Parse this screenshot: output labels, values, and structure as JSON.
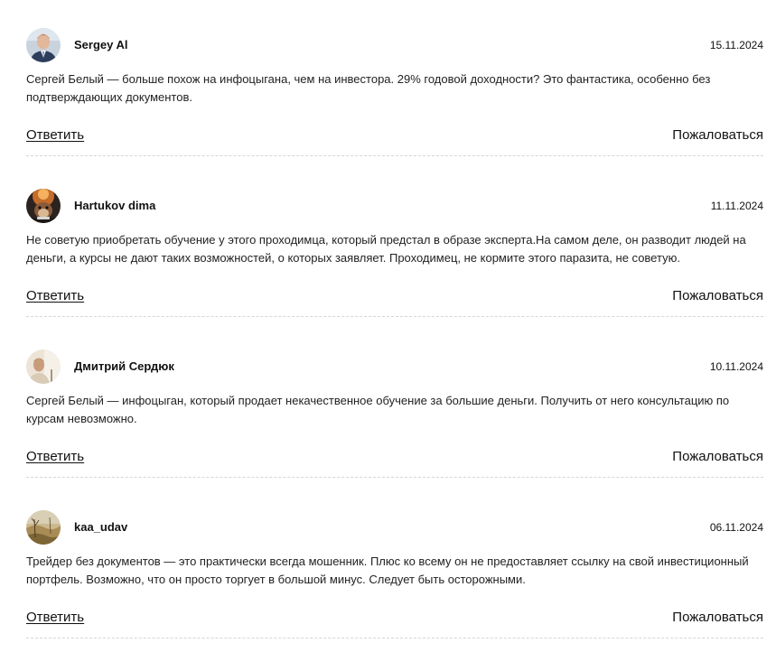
{
  "comments": [
    {
      "author": "Sergey Al",
      "date": "15.11.2024",
      "text": "Сергей Белый — больше похож на инфоцыгана, чем на инвестора. 29% годовой доходности? Это фантастика, особенно без подтверждающих документов.",
      "reply_label": "Ответить",
      "report_label": "Пожаловаться",
      "avatar": "man-in-suit-photo"
    },
    {
      "author": "Hartukov dima",
      "date": "11.11.2024",
      "text": "Не советую приобретать обучение у этого проходимца, который предстал в образе эксперта.На самом деле, он разводит людей на деньги, а курсы не дают таких возможностей, о которых заявляет. Проходимец, не кормите этого паразита, не советую.",
      "reply_label": "Ответить",
      "report_label": "Пожаловаться",
      "avatar": "animal-sunset-photo"
    },
    {
      "author": "Дмитрий Сердюк",
      "date": "10.11.2024",
      "text": "Сергей Белый — инфоцыган, который продает некачественное обучение за большие деньги. Получить от него консультацию по курсам невозможно.",
      "reply_label": "Ответить",
      "report_label": "Пожаловаться",
      "avatar": "man-light-background-photo"
    },
    {
      "author": "kaa_udav",
      "date": "06.11.2024",
      "text": "Трейдер без документов — это практически всегда мошенник. Плюс ко всему он не предоставляет ссылку на свой инвестиционный портфель. Возможно, что он просто торгует в большой минус. Следует быть осторожными.",
      "reply_label": "Ответить",
      "report_label": "Пожаловаться",
      "avatar": "field-landscape-photo"
    }
  ]
}
